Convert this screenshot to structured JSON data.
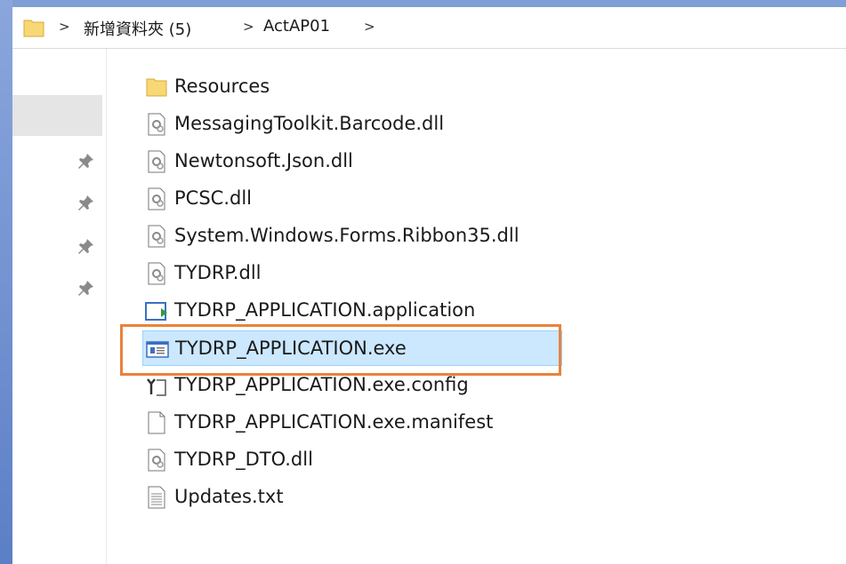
{
  "address_bar": {
    "segments": [
      "新增資料夾 (5)",
      "ActAP01"
    ],
    "separator": ">"
  },
  "nav_pane": {
    "pinned_count": 4
  },
  "files": [
    {
      "name": "Resources",
      "icon": "folder-icon"
    },
    {
      "name": "MessagingToolkit.Barcode.dll",
      "icon": "dll-file-icon"
    },
    {
      "name": "Newtonsoft.Json.dll",
      "icon": "dll-file-icon"
    },
    {
      "name": "PCSC.dll",
      "icon": "dll-file-icon"
    },
    {
      "name": "System.Windows.Forms.Ribbon35.dll",
      "icon": "dll-file-icon"
    },
    {
      "name": "TYDRP.dll",
      "icon": "dll-file-icon"
    },
    {
      "name": "TYDRP_APPLICATION.application",
      "icon": "application-manifest-icon"
    },
    {
      "name": "TYDRP_APPLICATION.exe",
      "icon": "exe-file-icon",
      "selected": true
    },
    {
      "name": "TYDRP_APPLICATION.exe.config",
      "icon": "config-file-icon"
    },
    {
      "name": "TYDRP_APPLICATION.exe.manifest",
      "icon": "blank-file-icon"
    },
    {
      "name": "TYDRP_DTO.dll",
      "icon": "dll-file-icon"
    },
    {
      "name": "Updates.txt",
      "icon": "text-file-icon"
    }
  ],
  "colors": {
    "selection_fill": "#cce8ff",
    "selection_border": "#99d1ff",
    "highlight_outline": "#e9823c",
    "folder_yellow": "#f8d775"
  }
}
